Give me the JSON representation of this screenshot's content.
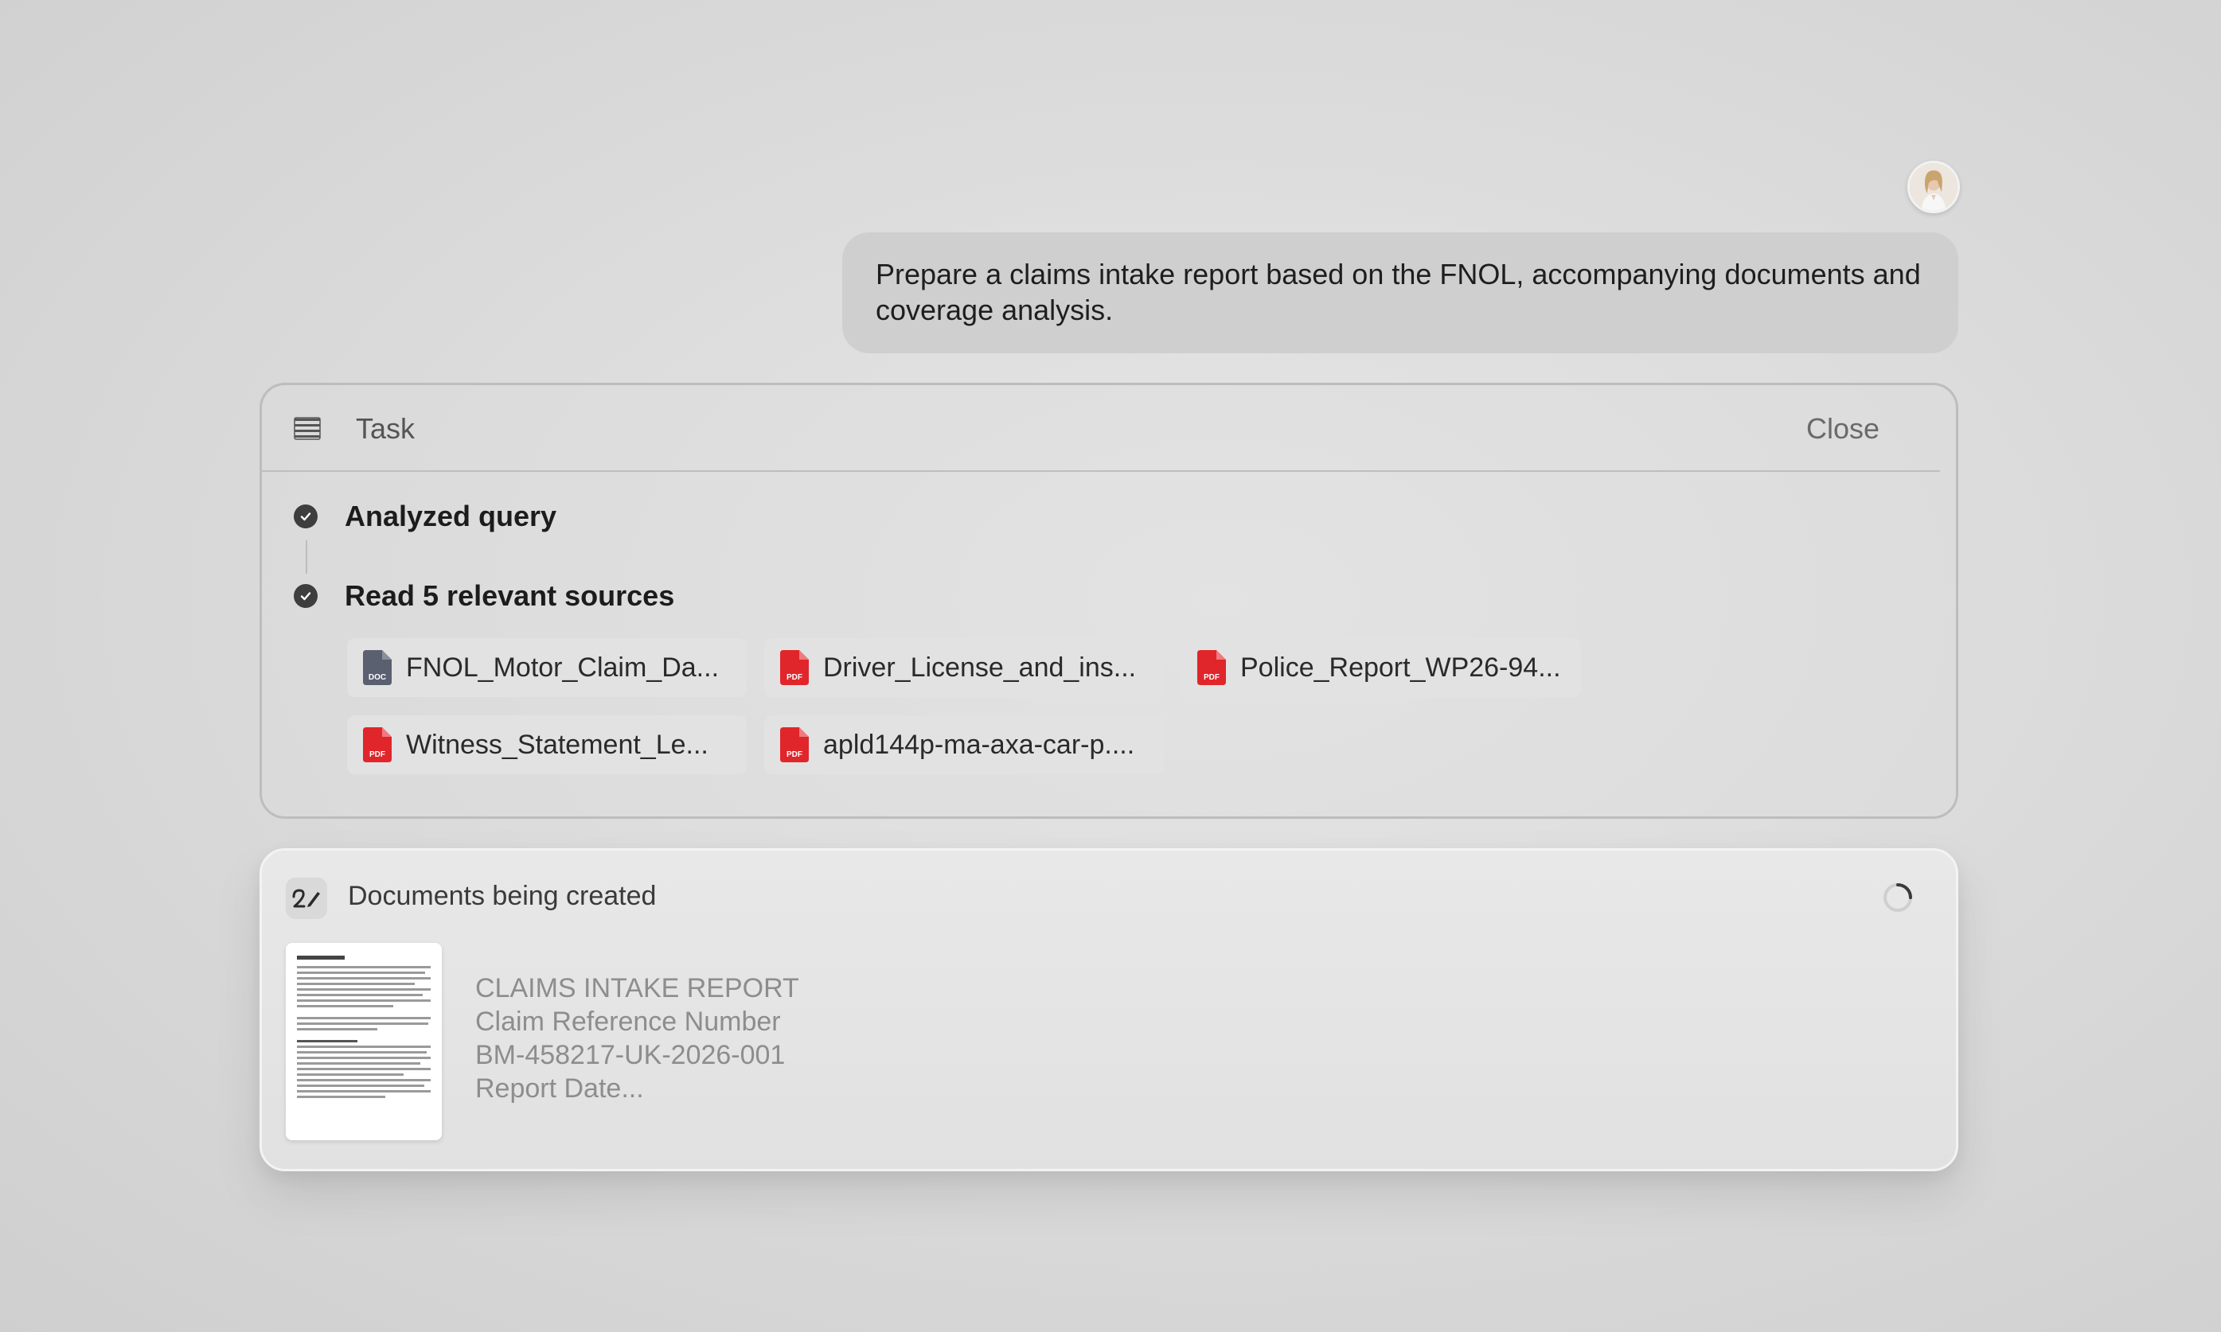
{
  "user_message": {
    "text": "Prepare a claims intake report based on the FNOL, accompanying documents and coverage analysis."
  },
  "task": {
    "title": "Task",
    "close_label": "Close",
    "steps": [
      {
        "label": "Analyzed query",
        "status": "done"
      },
      {
        "label": "Read 5 relevant sources",
        "status": "done"
      }
    ],
    "sources": [
      {
        "name": "FNOL_Motor_Claim_Da...",
        "type": "DOC",
        "icon": "doc-file-icon"
      },
      {
        "name": "Driver_License_and_ins...",
        "type": "PDF",
        "icon": "pdf-file-icon"
      },
      {
        "name": "Police_Report_WP26-94...",
        "type": "PDF",
        "icon": "pdf-file-icon"
      },
      {
        "name": "Witness_Statement_Le...",
        "type": "PDF",
        "icon": "pdf-file-icon"
      },
      {
        "name": "apld144p-ma-axa-car-p....",
        "type": "PDF",
        "icon": "pdf-file-icon"
      }
    ]
  },
  "documents": {
    "title": "Documents being created",
    "preview_lines": [
      "CLAIMS INTAKE REPORT",
      "Claim Reference Number",
      "BM-458217-UK-2026-001",
      "Report Date..."
    ]
  },
  "colors": {
    "pdf_red": "#e0262b",
    "doc_gray": "#5b6070",
    "check_fill": "#3e3e3e"
  }
}
